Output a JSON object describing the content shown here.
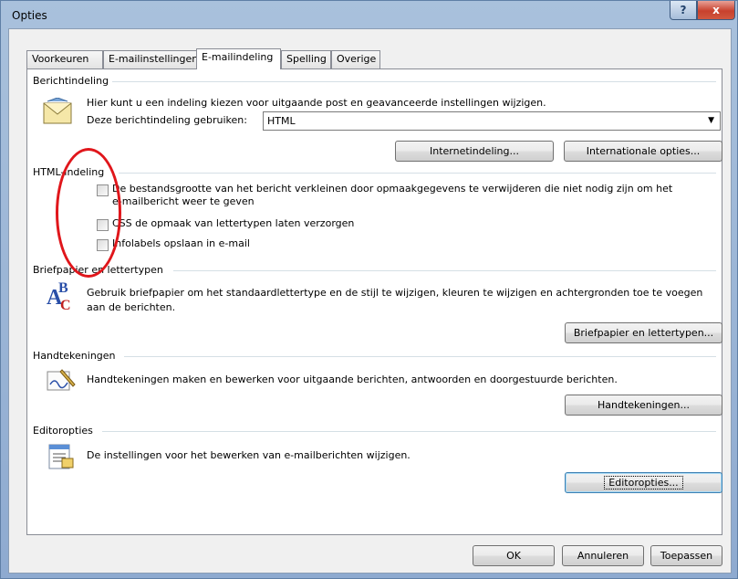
{
  "window": {
    "title": "Opties",
    "help_label": "?",
    "close_label": "x"
  },
  "tabs": [
    {
      "label": "Voorkeuren"
    },
    {
      "label": "E-mailinstellingen"
    },
    {
      "label": "E-mailindeling"
    },
    {
      "label": "Spelling"
    },
    {
      "label": "Overige"
    }
  ],
  "berichtindeling": {
    "title": "Berichtindeling",
    "description": "Hier kunt u een indeling kiezen voor uitgaande post en geavanceerde instellingen wijzigen.",
    "format_label": "Deze berichtindeling gebruiken:",
    "format_value": "HTML",
    "internet_button": "Internetindeling...",
    "international_button": "Internationale opties..."
  },
  "html_indeling": {
    "title": "HTML-indeling",
    "options": [
      {
        "label_line1": "De bestandsgrootte van het bericht verkleinen door opmaakgegevens te verwijderen die niet nodig zijn om het",
        "label_line2": "e-mailbericht weer te geven",
        "checked": false
      },
      {
        "label_line1": "CSS de opmaak van lettertypen laten verzorgen",
        "checked": false
      },
      {
        "label_line1": "Infolabels opslaan in e-mail",
        "checked": false
      }
    ]
  },
  "briefpapier": {
    "title": "Briefpapier en lettertypen",
    "description_line1": "Gebruik briefpapier om het standaardlettertype en de stijl te wijzigen, kleuren te wijzigen en achtergronden toe te voegen",
    "description_line2": "aan de berichten.",
    "button": "Briefpapier en lettertypen..."
  },
  "handtekeningen": {
    "title": "Handtekeningen",
    "description": "Handtekeningen maken en bewerken voor uitgaande berichten, antwoorden en doorgestuurde berichten.",
    "button": "Handtekeningen..."
  },
  "editoropties": {
    "title": "Editoropties",
    "description": "De instellingen voor het bewerken van e-mailberichten wijzigen.",
    "button": "Editoropties..."
  },
  "footer": {
    "ok": "OK",
    "cancel": "Annuleren",
    "apply": "Toepassen"
  },
  "colors": {
    "annotation": "#e0161b",
    "titlebar": "#a9c1dc"
  }
}
